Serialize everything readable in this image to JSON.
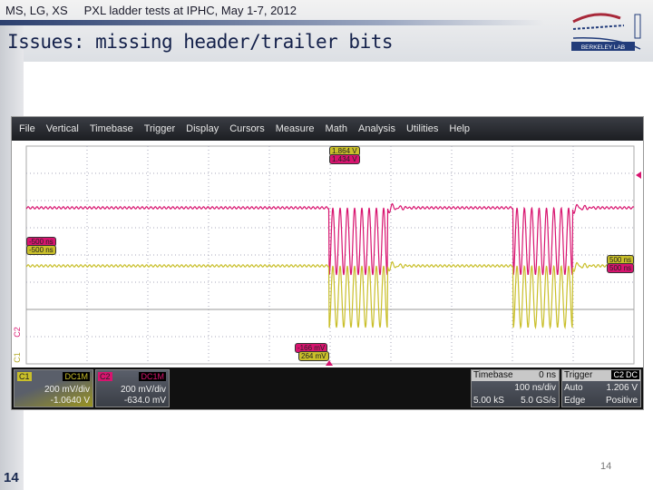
{
  "header": {
    "authors": "MS, LG, XS",
    "subtitle": "PXL ladder tests at IPHC, May 1-7, 2012"
  },
  "title": "Issues: missing header/trailer bits",
  "logo": {
    "text": "Berkeley Lab"
  },
  "slide_number": "14",
  "page_number": "14",
  "scope": {
    "menu": [
      "File",
      "Vertical",
      "Timebase",
      "Trigger",
      "Display",
      "Cursors",
      "Measure",
      "Math",
      "Analysis",
      "Utilities",
      "Help"
    ],
    "markers": {
      "top_yellow": "1.864 V",
      "top_pink": "1.434 V",
      "left_pink": "-500 ns",
      "left_yellow": "-500 ns",
      "right_yellow": "500 ns",
      "right_pink": "500 ns",
      "bottom_pink": "-166 mV",
      "bottom_yellow": "264 mV",
      "c2_label": "C2",
      "c1_label": "C1"
    },
    "c1": {
      "name": "C1",
      "coupling": "DC1M",
      "vdiv": "200 mV/div",
      "offset": "-1.0640 V",
      "color": "#c9bf2a"
    },
    "c2": {
      "name": "C2",
      "coupling": "DC1M",
      "vdiv": "200 mV/div",
      "offset": "-634.0 mV",
      "color": "#d8146f"
    },
    "timebase": {
      "label": "Timebase",
      "delay": "0 ns",
      "tdiv": "100 ns/div",
      "samples": "5.00 kS",
      "rate": "5.0 GS/s"
    },
    "trigger": {
      "label": "Trigger",
      "source": "C2",
      "coupling": "DC",
      "mode": "Auto",
      "level": "1.206 V",
      "type": "Edge",
      "slope": "Positive"
    }
  }
}
